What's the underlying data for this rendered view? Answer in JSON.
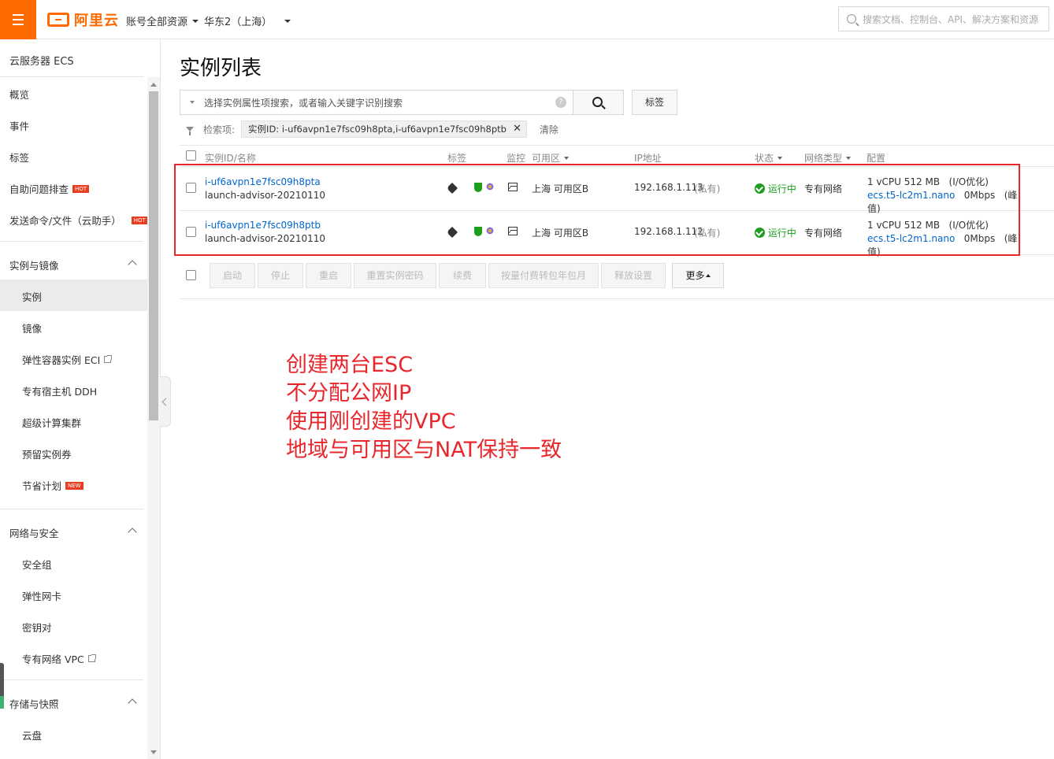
{
  "header": {
    "logo_text": "阿里云",
    "account_scope": "账号全部资源",
    "region": "华东2（上海）",
    "search_placeholder": "搜索文档、控制台、API、解决方案和资源"
  },
  "sidebar": {
    "title": "云服务器 ECS",
    "items": [
      {
        "label": "概览"
      },
      {
        "label": "事件"
      },
      {
        "label": "标签"
      },
      {
        "label": "自助问题排查",
        "badge": "HOT"
      },
      {
        "label": "发送命令/文件（云助手）",
        "badge": "HOT"
      }
    ],
    "group1": {
      "label": "实例与镜像",
      "items": [
        {
          "label": "实例"
        },
        {
          "label": "镜像"
        },
        {
          "label": "弹性容器实例 ECI"
        },
        {
          "label": "专有宿主机 DDH"
        },
        {
          "label": "超级计算集群"
        },
        {
          "label": "预留实例券"
        },
        {
          "label": "节省计划",
          "badge": "NEW"
        }
      ]
    },
    "group2": {
      "label": "网络与安全",
      "items": [
        {
          "label": "安全组"
        },
        {
          "label": "弹性网卡"
        },
        {
          "label": "密钥对"
        },
        {
          "label": "专有网络 VPC"
        }
      ]
    },
    "group3": {
      "label": "存储与快照",
      "items": [
        {
          "label": "云盘"
        }
      ]
    }
  },
  "main": {
    "title": "实例列表",
    "search_placeholder": "选择实例属性项搜索，或者输入关键字识别搜索",
    "tag_button": "标签",
    "filter_label": "检索项:",
    "filter_chip": "实例ID: i-uf6avpn1e7fsc09h8pta,i-uf6avpn1e7fsc09h8ptb",
    "clear_label": "清除",
    "columns": [
      "实例ID/名称",
      "标签",
      "监控",
      "可用区",
      "IP地址",
      "状态",
      "网络类型",
      "配置"
    ],
    "rows": [
      {
        "id": "i-uf6avpn1e7fsc09h8pta",
        "name": "launch-advisor-20210110",
        "zone": "上海 可用区B",
        "ip": "192.168.1.113",
        "ip_type": "(私有)",
        "status": "运行中",
        "network": "专有网络",
        "spec": "1 vCPU 512 MB",
        "io": "(I/O优化)",
        "instance_type": "ecs.t5-lc2m1.nano",
        "bandwidth": "0Mbps",
        "bandwidth_note": "(峰值)"
      },
      {
        "id": "i-uf6avpn1e7fsc09h8ptb",
        "name": "launch-advisor-20210110",
        "zone": "上海 可用区B",
        "ip": "192.168.1.112",
        "ip_type": "(私有)",
        "status": "运行中",
        "network": "专有网络",
        "spec": "1 vCPU 512 MB",
        "io": "(I/O优化)",
        "instance_type": "ecs.t5-lc2m1.nano",
        "bandwidth": "0Mbps",
        "bandwidth_note": "(峰值)"
      }
    ],
    "actions": [
      "启动",
      "停止",
      "重启",
      "重置实例密码",
      "续费",
      "按量付费转包年包月",
      "释放设置"
    ],
    "more_label": "更多"
  },
  "annotation": {
    "lines": [
      "创建两台ESC",
      "不分配公网IP",
      "使用刚创建的VPC",
      "地域与可用区与NAT保持一致"
    ],
    "color": "#e8272c"
  },
  "colors": {
    "brand": "#ff6a00",
    "link": "#0066cc",
    "running": "#1e9e1e"
  },
  "icons": [
    "menu-icon",
    "search-icon",
    "help-icon",
    "filter-icon",
    "tag-icon",
    "shield-icon",
    "flower-icon",
    "monitor-icon",
    "check-circle-icon"
  ]
}
